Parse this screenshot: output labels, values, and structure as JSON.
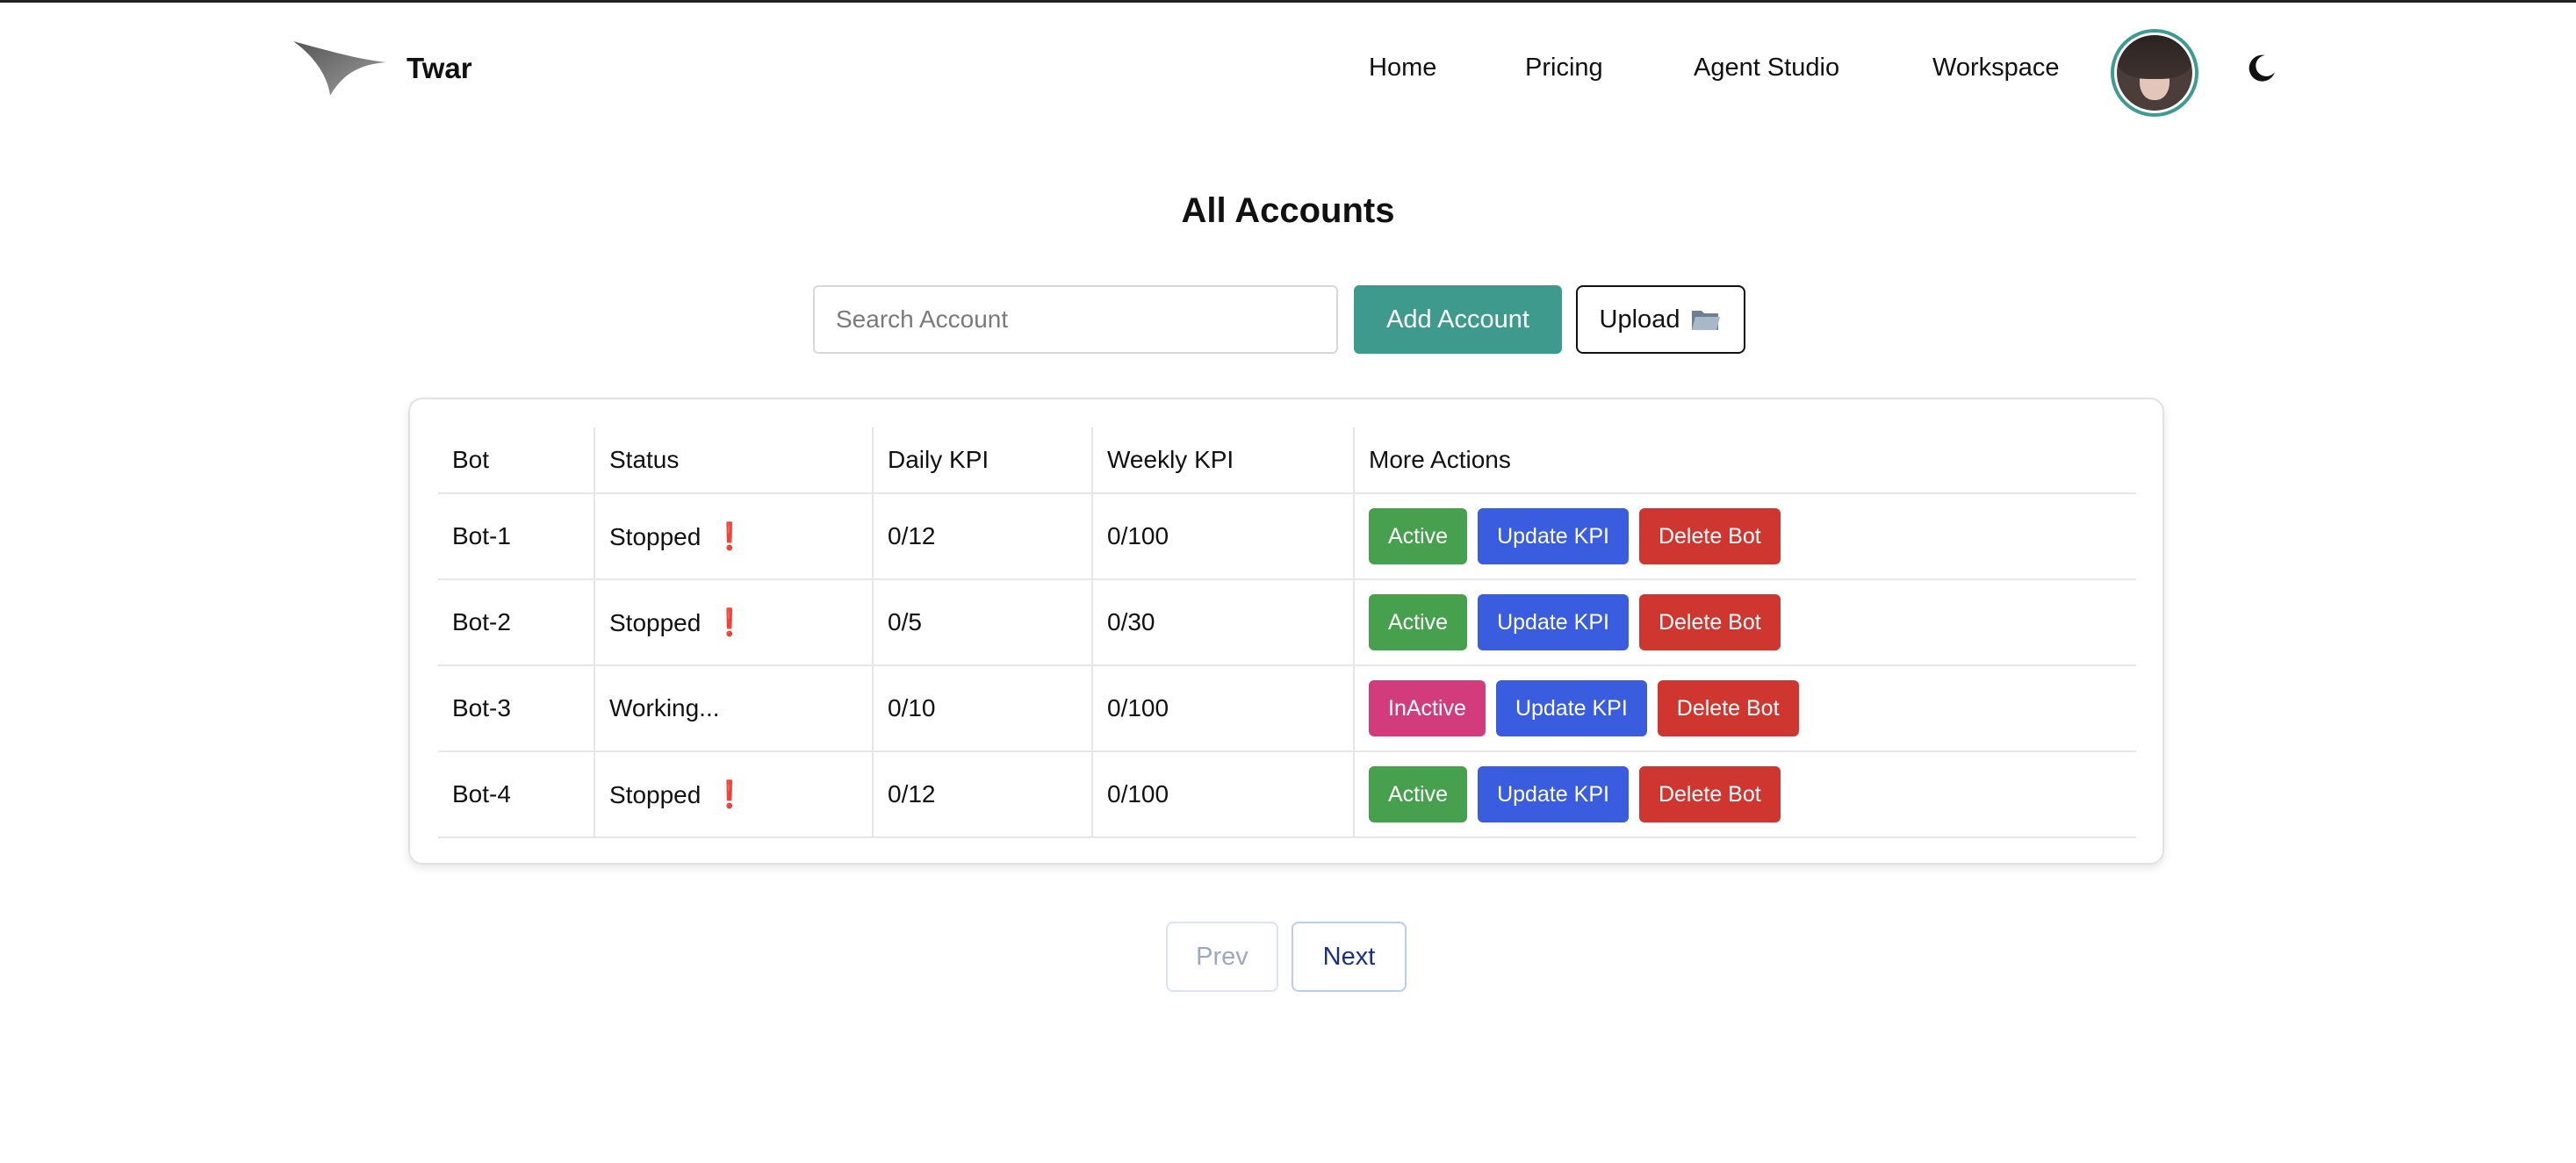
{
  "header": {
    "brand": "Twar",
    "nav": [
      {
        "label": "Home"
      },
      {
        "label": "Pricing"
      },
      {
        "label": "Agent Studio"
      },
      {
        "label": "Workspace"
      }
    ]
  },
  "page": {
    "title": "All Accounts"
  },
  "toolbar": {
    "search_placeholder": "Search Account",
    "add_label": "Add Account",
    "upload_label": "Upload"
  },
  "table": {
    "headers": [
      "Bot",
      "Status",
      "Daily KPI",
      "Weekly KPI",
      "More Actions"
    ],
    "rows": [
      {
        "bot": "Bot-1",
        "status": "Stopped",
        "warn": "❗",
        "daily": "0/12",
        "weekly": "0/100",
        "toggle": "Active",
        "update": "Update KPI",
        "delete": "Delete Bot"
      },
      {
        "bot": "Bot-2",
        "status": "Stopped",
        "warn": "❗",
        "daily": "0/5",
        "weekly": "0/30",
        "toggle": "Active",
        "update": "Update KPI",
        "delete": "Delete Bot"
      },
      {
        "bot": "Bot-3",
        "status": "Working...",
        "warn": "",
        "daily": "0/10",
        "weekly": "0/100",
        "toggle": "InActive",
        "update": "Update KPI",
        "delete": "Delete Bot"
      },
      {
        "bot": "Bot-4",
        "status": "Stopped",
        "warn": "❗",
        "daily": "0/12",
        "weekly": "0/100",
        "toggle": "Active",
        "update": "Update KPI",
        "delete": "Delete Bot"
      }
    ]
  },
  "pagination": {
    "prev": "Prev",
    "next": "Next"
  },
  "colors": {
    "accent_teal": "#3e9a8c",
    "active_green": "#46a04e",
    "inactive_pink": "#d23b7c",
    "update_blue": "#3a5ddf",
    "delete_red": "#d03630"
  },
  "icons": [
    "logo-icon",
    "avatar",
    "moon-icon",
    "folder-icon",
    "warning-icon"
  ]
}
